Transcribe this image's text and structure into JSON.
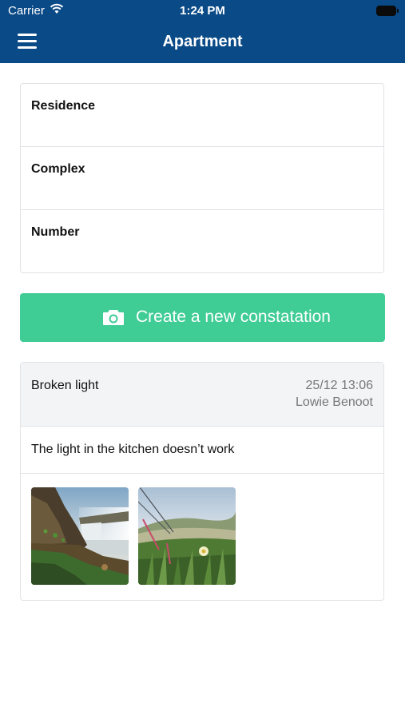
{
  "status_bar": {
    "carrier": "Carrier",
    "time": "1:24 PM"
  },
  "nav": {
    "title": "Apartment",
    "menu_icon": "hamburger-menu-icon"
  },
  "fields": [
    {
      "label": "Residence"
    },
    {
      "label": "Complex"
    },
    {
      "label": "Number"
    }
  ],
  "create_button": {
    "label": "Create a new constatation",
    "icon": "camera-icon"
  },
  "report": {
    "title": "Broken light",
    "date": "25/12 13:06",
    "author": "Lowie Benoot",
    "description": "The light in the kitchen doesn’t work",
    "photos": [
      {
        "name": "waterfall-photo"
      },
      {
        "name": "flower-photo"
      }
    ]
  },
  "colors": {
    "nav_bg": "#0a4a87",
    "accent_green": "#3fcc95",
    "card_header_bg": "#f3f4f6",
    "muted_text": "#777777"
  }
}
